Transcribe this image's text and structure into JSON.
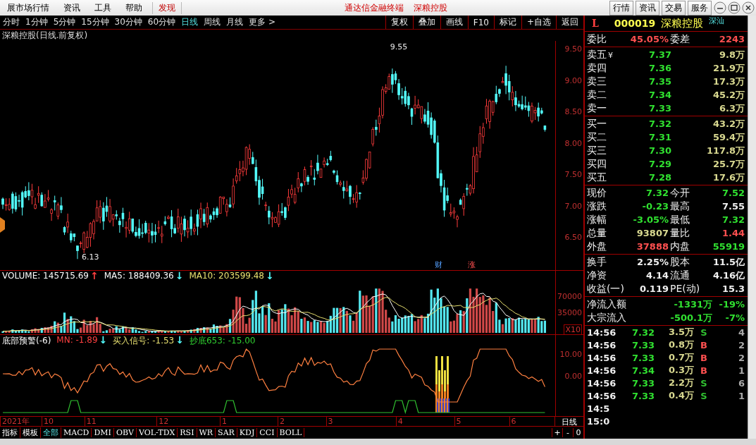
{
  "menu_bar": {
    "items": [
      {
        "label": "展市场行情",
        "selected": false
      },
      {
        "label": "资讯",
        "selected": false
      },
      {
        "label": "工具",
        "selected": false
      },
      {
        "label": "帮助",
        "selected": false
      },
      {
        "label": "发现",
        "selected": true
      }
    ],
    "app_title": "通达信金融终端",
    "stock_title": "深粮控股",
    "buttons": [
      "行情",
      "资讯",
      "交易",
      "服务"
    ]
  },
  "chart_toolbar": {
    "periods": [
      {
        "label": "分时",
        "selected": false
      },
      {
        "label": "1分钟",
        "selected": false
      },
      {
        "label": "5分钟",
        "selected": false
      },
      {
        "label": "15分钟",
        "selected": false
      },
      {
        "label": "30分钟",
        "selected": false
      },
      {
        "label": "60分钟",
        "selected": false
      },
      {
        "label": "日线",
        "selected": true
      },
      {
        "label": "周线",
        "selected": false
      },
      {
        "label": "月线",
        "selected": false
      },
      {
        "label": "更多 >",
        "selected": false
      }
    ],
    "actions": [
      "复权",
      "叠加",
      "画线",
      "F10",
      "标记",
      "+自选",
      "返回"
    ]
  },
  "chart_title": "深粮控股(日线.前复权)",
  "price_pane": {
    "axis": [
      "9.50",
      "9.00",
      "8.50",
      "8.00",
      "7.50",
      "7.00",
      "6.50"
    ],
    "high_label": "9.55",
    "low_label": "6.13",
    "markers": [
      "财",
      "涨"
    ]
  },
  "volume_pane": {
    "legend": [
      {
        "text": "VOLUME: 145715.69",
        "arrow": {
          "symbol": "↑",
          "color": "#ff4040"
        },
        "color": "#ffffff"
      },
      {
        "text": "MA5: 188409.36",
        "arrow": {
          "symbol": "↓",
          "color": "#54ffff"
        },
        "color": "#ffffff"
      },
      {
        "text": "MA10: 203599.48",
        "arrow": {
          "symbol": "↓",
          "color": "#54ffff"
        },
        "color": "#e8e070"
      }
    ],
    "axis": [
      "70000",
      "35000"
    ],
    "unit": "X10"
  },
  "indicator_pane": {
    "legend": [
      {
        "text": "底部预警(-6)",
        "color": "#ffffff"
      },
      {
        "text": "MN: -1.89",
        "arrow": {
          "symbol": "↓",
          "color": "#54ffff"
        },
        "color": "#ff4040"
      },
      {
        "text": "买入信号: -1.53",
        "arrow": {
          "symbol": "↓",
          "color": "#54ffff"
        },
        "color": "#e8e070"
      },
      {
        "text": "抄底653: -15.00",
        "color": "#30d030"
      }
    ],
    "axis": [
      "10.00",
      "0.00"
    ]
  },
  "date_axis": {
    "labels": [
      "2021年",
      "10",
      "11",
      "12",
      "1",
      "2",
      "3",
      "4",
      "5",
      "6"
    ],
    "period": "日线"
  },
  "bottom_tabs": {
    "tabs": [
      {
        "label": "指标",
        "selected": false
      },
      {
        "label": "模板",
        "selected": false
      },
      {
        "label": "全部",
        "selected": true
      },
      {
        "label": "MACD",
        "selected": false
      },
      {
        "label": "DMI",
        "selected": false
      },
      {
        "label": "OBV",
        "selected": false
      },
      {
        "label": "VOL-TDX",
        "selected": false
      },
      {
        "label": "RSI",
        "selected": false
      },
      {
        "label": "WR",
        "selected": false
      },
      {
        "label": "SAR",
        "selected": false
      },
      {
        "label": "KDJ",
        "selected": false
      },
      {
        "label": "CCI",
        "selected": false
      },
      {
        "label": "BOLL",
        "selected": false
      }
    ],
    "zoom_buttons": [
      "+",
      "-",
      "0"
    ]
  },
  "quote_panel": {
    "flag": "L",
    "code": "000019",
    "name": "深粮控股",
    "tag": "深汕",
    "commission": {
      "ratio_label": "委比",
      "ratio": "45.05%",
      "diff_label": "委差",
      "diff": "2243"
    },
    "asks": [
      {
        "label": "卖五",
        "symbol": "¥",
        "price": "7.37",
        "volume": "9.8万"
      },
      {
        "label": "卖四",
        "price": "7.36",
        "volume": "21.9万"
      },
      {
        "label": "卖三",
        "price": "7.35",
        "volume": "17.3万"
      },
      {
        "label": "卖二",
        "price": "7.34",
        "volume": "45.2万"
      },
      {
        "label": "卖一",
        "price": "7.33",
        "volume": "6.3万"
      }
    ],
    "bids": [
      {
        "label": "买一",
        "price": "7.32",
        "volume": "43.2万"
      },
      {
        "label": "买二",
        "price": "7.31",
        "volume": "59.4万"
      },
      {
        "label": "买三",
        "price": "7.30",
        "volume": "117.8万"
      },
      {
        "label": "买四",
        "price": "7.29",
        "volume": "25.7万"
      },
      {
        "label": "买五",
        "price": "7.28",
        "volume": "17.6万"
      }
    ],
    "quotes": [
      {
        "left": {
          "label": "现价",
          "value": "7.32",
          "color": "#30e030"
        },
        "right": {
          "label": "今开",
          "value": "7.52",
          "color": "#30e030"
        }
      },
      {
        "left": {
          "label": "涨跌",
          "value": "-0.23",
          "color": "#30e030"
        },
        "right": {
          "label": "最高",
          "value": "7.55",
          "color": "#f0f0f0"
        }
      },
      {
        "left": {
          "label": "涨幅",
          "value": "-3.05%",
          "color": "#30e030"
        },
        "right": {
          "label": "最低",
          "value": "7.32",
          "color": "#30e030"
        }
      },
      {
        "left": {
          "label": "总量",
          "value": "93807",
          "color": "#d8d890"
        },
        "right": {
          "label": "量比",
          "value": "1.44",
          "color": "#ff5050"
        }
      },
      {
        "left": {
          "label": "外盘",
          "value": "37888",
          "color": "#ff5050"
        },
        "right": {
          "label": "内盘",
          "value": "55919",
          "color": "#30e030"
        }
      }
    ],
    "stats": [
      {
        "left": {
          "label": "换手",
          "value": "2.25%"
        },
        "right": {
          "label": "股本",
          "value": "11.5亿"
        }
      },
      {
        "left": {
          "label": "净资",
          "value": "4.14"
        },
        "right": {
          "label": "流通",
          "value": "4.16亿"
        }
      },
      {
        "left": {
          "label": "收益(一)",
          "value": "0.119"
        },
        "right": {
          "label": "PE(动)",
          "value": "15.3"
        }
      }
    ],
    "flows": [
      {
        "label": "净流入额",
        "amount": "-1331万",
        "percent": "-19%"
      },
      {
        "label": "大宗流入",
        "amount": "-500.1万",
        "percent": "-7%"
      }
    ],
    "trades": [
      {
        "time": "14:56",
        "price": "7.32",
        "volume": "3.5万",
        "side": "S",
        "color": "#30c030",
        "count": "4"
      },
      {
        "time": "14:56",
        "price": "7.33",
        "volume": "0.8万",
        "side": "B",
        "color": "#ff5050",
        "count": "2"
      },
      {
        "time": "14:56",
        "price": "7.33",
        "volume": "0.7万",
        "side": "B",
        "color": "#ff5050",
        "count": "2"
      },
      {
        "time": "14:56",
        "price": "7.34",
        "volume": "0.3万",
        "side": "B",
        "color": "#ff5050",
        "count": "1"
      },
      {
        "time": "14:56",
        "price": "7.33",
        "volume": "2.2万",
        "side": "S",
        "color": "#30c030",
        "count": "6"
      },
      {
        "time": "14:56",
        "price": "7.33",
        "volume": "0.4万",
        "side": "S",
        "color": "#30c030",
        "count": "1"
      },
      {
        "time": "14:5"
      },
      {
        "time": "15:0"
      }
    ]
  }
}
